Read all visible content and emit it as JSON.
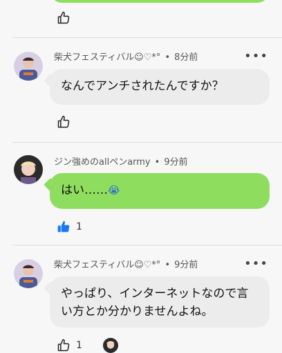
{
  "comments": [
    {
      "author": "柴犬フェスティバル☺♡*°",
      "time": "8分前",
      "text": "なんでアンチされたんですか？",
      "likes": ""
    },
    {
      "author": "ジン強めのallペンarmy",
      "time": "9分前",
      "text": "はい……",
      "text_emoji": "😭",
      "likes": "1"
    },
    {
      "author": "柴犬フェスティバル☺♡*°",
      "time": "9分前",
      "text": "やっぱり、インターネットなので言い方とか分かりませんよね。",
      "likes": "1"
    }
  ],
  "separator": "•",
  "more_glyph": "•••",
  "colors": {
    "green_bubble": "#8fdd5f",
    "gray_bubble": "#ececec",
    "liked_blue": "#1877f2"
  },
  "icons": [
    "thumbs-up-outline-icon",
    "thumbs-up-filled-icon",
    "more-icon"
  ]
}
